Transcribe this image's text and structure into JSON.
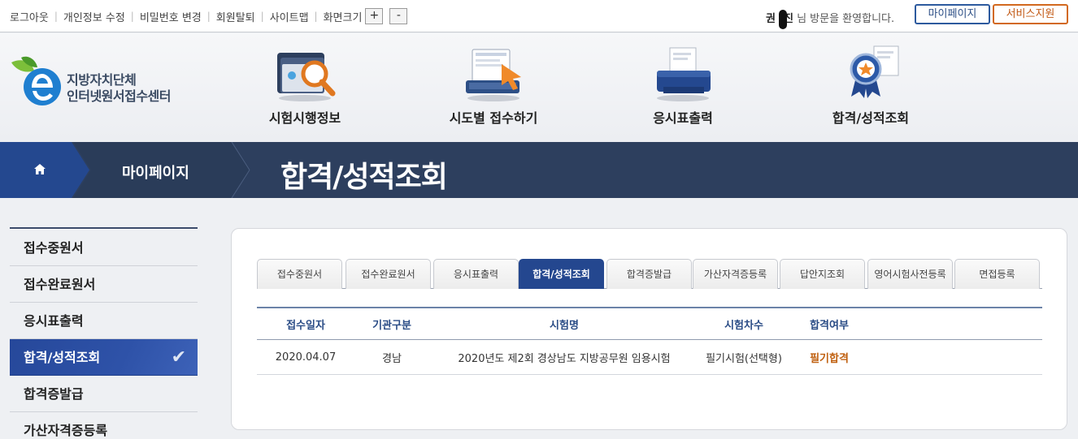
{
  "util": {
    "links": [
      "로그아웃",
      "개인정보 수정",
      "비밀번호 변경",
      "회원탈퇴",
      "사이트맵"
    ],
    "font_size_label": "화면크기",
    "font_plus": "+",
    "font_minus": "-",
    "user_name_first": "권",
    "user_name_last": "진",
    "welcome_text": "님 방문을 환영합니다.",
    "mypage_button": "마이페이지",
    "service_button": "서비스지원"
  },
  "logo": {
    "line1": "지방자치단체",
    "line2": "인터넷원서접수센터"
  },
  "nav": [
    {
      "label": "시험시행정보",
      "icon": "folder-search-icon"
    },
    {
      "label": "시도별 접수하기",
      "icon": "laptop-click-icon"
    },
    {
      "label": "응시표출력",
      "icon": "printer-icon"
    },
    {
      "label": "합격/성적조회",
      "icon": "award-certificate-icon"
    }
  ],
  "breadcrumb": {
    "section": "마이페이지",
    "title": "합격/성적조회"
  },
  "sidebar": {
    "items": [
      {
        "label": "접수중원서"
      },
      {
        "label": "접수완료원서"
      },
      {
        "label": "응시표출력"
      },
      {
        "label": "합격/성적조회"
      },
      {
        "label": "합격증발급"
      },
      {
        "label": "가산자격증등록"
      }
    ],
    "active_index": 3
  },
  "tabs": [
    "접수중원서",
    "접수완료원서",
    "응시표출력",
    "합격/성적조회",
    "합격증발급",
    "가산자격증등록",
    "답안지조회",
    "영어시험사전등록",
    "면접등록"
  ],
  "table": {
    "headers": [
      "접수일자",
      "기관구분",
      "시험명",
      "시험차수",
      "합격여부"
    ],
    "rows": [
      [
        "2020.04.07",
        "경남",
        "2020년도 제2회 경상남도 지방공무원 임용시험",
        "필기시험(선택형)",
        "필기합격"
      ]
    ]
  },
  "colors": {
    "primary_navy": "#2d3f5e",
    "active_blue": "#24478f",
    "pass_orange": "#c06010",
    "service_orange": "#d2691e"
  }
}
